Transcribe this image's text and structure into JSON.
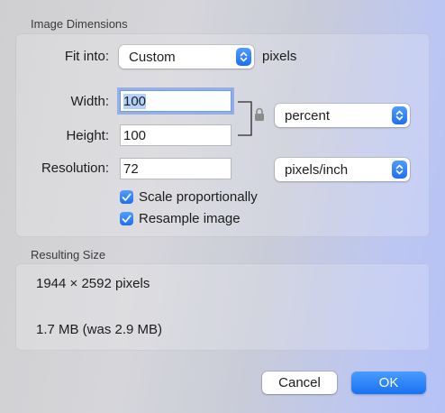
{
  "dimensions": {
    "title": "Image Dimensions",
    "fit_into": {
      "label": "Fit into:",
      "value": "Custom",
      "unit": "pixels"
    },
    "width": {
      "label": "Width:",
      "value": "100"
    },
    "height": {
      "label": "Height:",
      "value": "100"
    },
    "size_unit": {
      "value": "percent"
    },
    "resolution": {
      "label": "Resolution:",
      "value": "72",
      "unit": "pixels/inch"
    },
    "scale_proportionally": {
      "label": "Scale proportionally",
      "checked": true
    },
    "resample_image": {
      "label": "Resample image",
      "checked": true
    },
    "lock_icon": "lock-icon"
  },
  "result": {
    "title": "Resulting Size",
    "pixels": "1944 × 2592 pixels",
    "file_size": "1.7 MB (was 2.9 MB)"
  },
  "buttons": {
    "cancel": "Cancel",
    "ok": "OK"
  },
  "colors": {
    "accent": "#1f6ff0",
    "selection": "#b3d1fb"
  }
}
